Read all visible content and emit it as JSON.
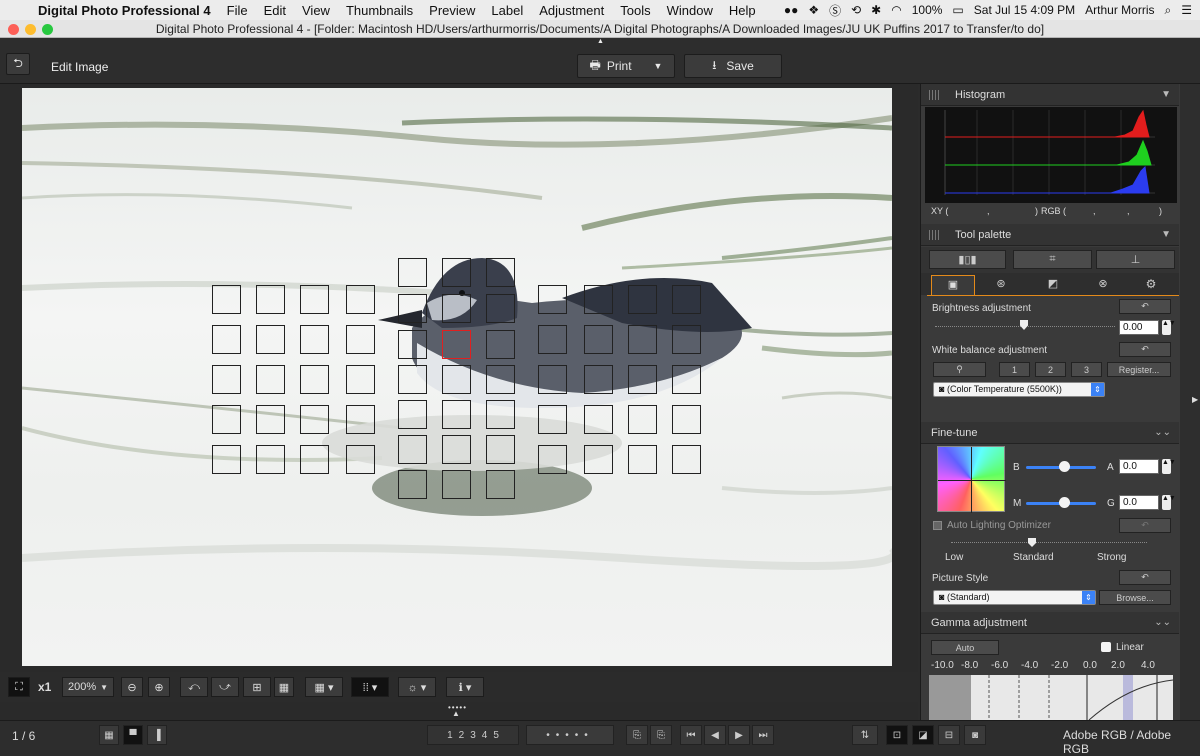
{
  "menubar": {
    "app": "Digital Photo Professional 4",
    "items": [
      "File",
      "Edit",
      "View",
      "Thumbnails",
      "Preview",
      "Label",
      "Adjustment",
      "Tools",
      "Window",
      "Help"
    ],
    "battery": "100%",
    "datetime": "Sat Jul 15  4:09 PM",
    "user": "Arthur Morris"
  },
  "window": {
    "title": "Digital Photo Professional 4 - [Folder: Macintosh HD/Users/arthurmorris/Documents/A Digital Photographs/A Downloaded Images/JU UK Puffins 2017 to Transfer/to do]"
  },
  "toolbar": {
    "mode_label": "Edit Image",
    "print_label": "Print",
    "save_label": "Save"
  },
  "histogram": {
    "title": "Histogram",
    "xy_label": "XY (",
    "xy_sep": ",",
    "xy_close": ")",
    "rgb_label": "RGB (",
    "rgb_sep1": ",",
    "rgb_sep2": ",",
    "rgb_close": ")"
  },
  "tool_palette": {
    "title": "Tool palette",
    "brightness_label": "Brightness adjustment",
    "brightness_value": "0.00",
    "wb_label": "White balance adjustment",
    "wb_buttons": [
      "1",
      "2",
      "3"
    ],
    "register_label": "Register...",
    "wb_select": "(Color Temperature (5500K))"
  },
  "fine_tune": {
    "title": "Fine-tune",
    "b_label": "B",
    "a_label": "A",
    "a_value": "0.0",
    "m_label": "M",
    "g_label": "G",
    "g_value": "0.0",
    "alo_label": "Auto Lighting Optimizer",
    "alo_low": "Low",
    "alo_standard": "Standard",
    "alo_strong": "Strong",
    "picture_style_label": "Picture Style",
    "picture_style_value": "(Standard)",
    "browse_label": "Browse..."
  },
  "gamma": {
    "title": "Gamma adjustment",
    "auto_label": "Auto",
    "linear_label": "Linear",
    "ticks": [
      "-10.0",
      "-8.0",
      "-6.0",
      "-4.0",
      "-2.0",
      "0.0",
      "2.0",
      "4.0"
    ]
  },
  "bottom_toolbar": {
    "zoom_x1": "x1",
    "zoom_level": "200%"
  },
  "status": {
    "page": "1 / 6",
    "ratings": [
      "1",
      "2",
      "3",
      "4",
      "5"
    ],
    "color_space": "Adobe RGB / Adobe RGB"
  },
  "colors": {
    "accent_blue": "#3b82f6",
    "af_red": "#e02020"
  }
}
